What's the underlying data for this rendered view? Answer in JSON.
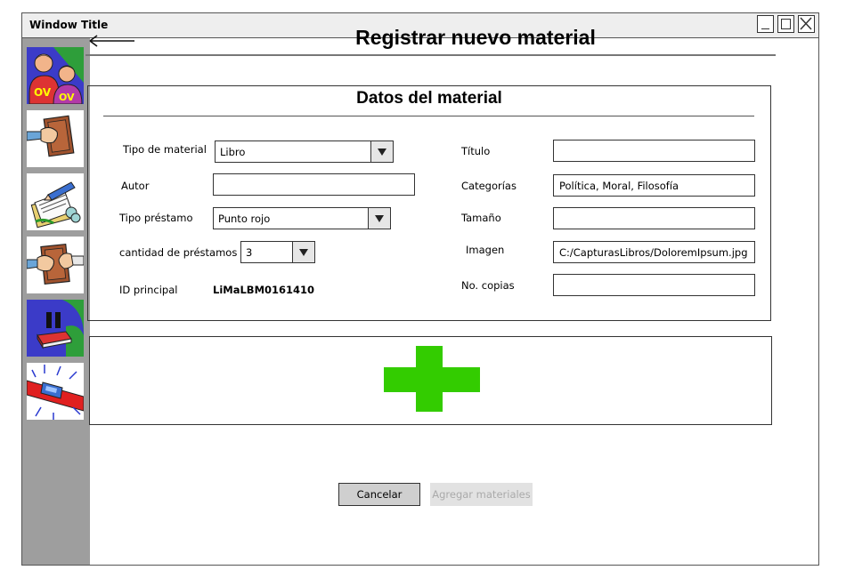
{
  "window": {
    "title": "Window Title"
  },
  "sidebar": {
    "items": [
      {
        "icon": "users-icon"
      },
      {
        "icon": "book-handover-icon"
      },
      {
        "icon": "documents-icon"
      },
      {
        "icon": "book-return-icon"
      },
      {
        "icon": "pause-book-icon"
      },
      {
        "icon": "alarm-light-icon"
      }
    ]
  },
  "header": {
    "title": "Registrar nuevo material"
  },
  "form": {
    "title": "Datos del material",
    "tipo_material": {
      "label": "Tipo de material",
      "value": "Libro"
    },
    "autor": {
      "label": "Autor",
      "value": ""
    },
    "tipo_prestamo": {
      "label": "Tipo préstamo",
      "value": "Punto rojo"
    },
    "cantidad_prestamos": {
      "label": "cantidad de préstamos",
      "value": "3"
    },
    "id_principal": {
      "label": "ID principal",
      "value": "LiMaLBM0161410"
    },
    "titulo": {
      "label": "Título",
      "value": ""
    },
    "categorias": {
      "label": "Categorías",
      "value": "Política, Moral, Filosofía"
    },
    "tamano": {
      "label": "Tamaño",
      "value": ""
    },
    "imagen": {
      "label": "Imagen",
      "value": "C:/CapturasLibros/DoloremIpsum.jpg"
    },
    "copias": {
      "label": "No. copias",
      "value": ""
    }
  },
  "add_area": {
    "icon": "plus-icon",
    "color": "#33cc00"
  },
  "actions": {
    "cancel_label": "Cancelar",
    "add_label": "Agregar materiales",
    "add_disabled": true
  }
}
